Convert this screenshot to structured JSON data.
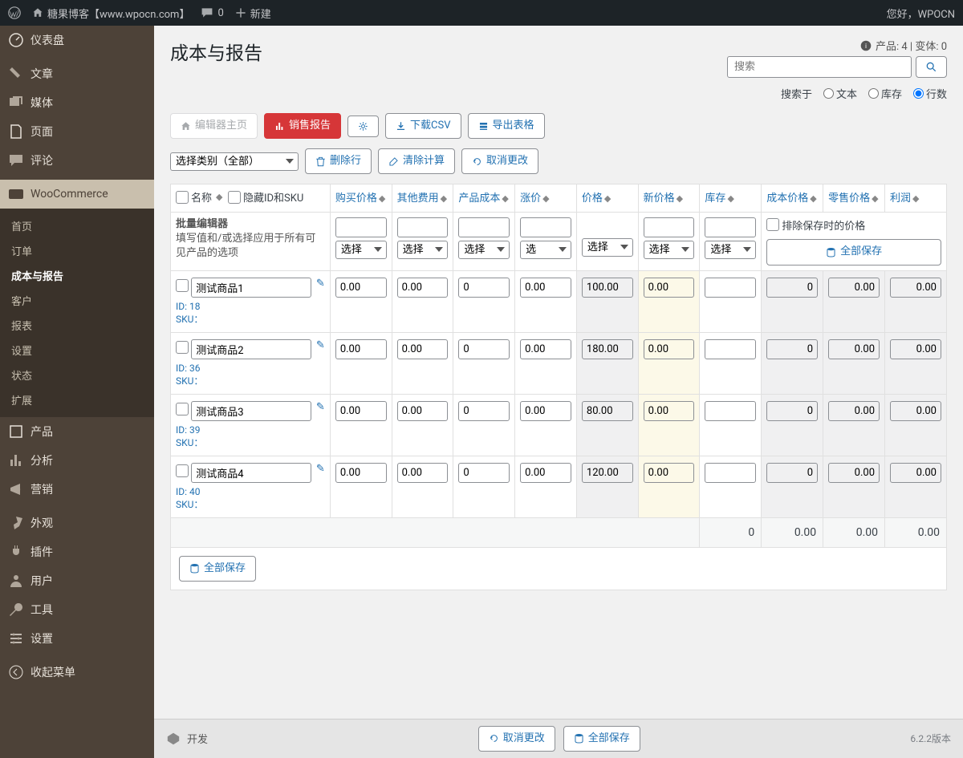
{
  "adminbar": {
    "site_title": "糖果博客【www.wpocn.com】",
    "comments": "0",
    "new": "新建",
    "greeting": "您好，WPOCN"
  },
  "sidebar": {
    "dashboard": "仪表盘",
    "posts": "文章",
    "media": "媒体",
    "pages": "页面",
    "comments": "评论",
    "woocommerce": "WooCommerce",
    "woosub": {
      "home": "首页",
      "orders": "订单",
      "cost_reports": "成本与报告",
      "customers": "客户",
      "reports": "报表",
      "settings": "设置",
      "status": "状态",
      "extensions": "扩展"
    },
    "products": "产品",
    "analytics": "分析",
    "marketing": "营销",
    "appearance": "外观",
    "plugins": "插件",
    "users": "用户",
    "tools": "工具",
    "settings": "设置",
    "collapse": "收起菜单"
  },
  "page": {
    "title": "成本与报告",
    "info_prefix": "产品: 4 | 变体: 0"
  },
  "toolbar": {
    "editor_home": "编辑器主页",
    "sales_report": "销售报告",
    "download_csv": "下载CSV",
    "export_table": "导出表格",
    "search_placeholder": "搜索",
    "search_by": "搜索于",
    "r_text": "文本",
    "r_stock": "库存",
    "r_rows": "行数",
    "select_category": "选择类别（全部）",
    "delete_rows": "删除行",
    "clear_calc": "清除计算",
    "undo_changes": "取消更改"
  },
  "table": {
    "headers": {
      "name": "名称",
      "hide_id_sku": "隐藏ID和SKU",
      "purchase_price": "购买价格",
      "other_cost": "其他费用",
      "product_cost": "产品成本",
      "markup": "涨价",
      "price": "价格",
      "new_price": "新价格",
      "stock": "库存",
      "cost_price": "成本价格",
      "retail_price": "零售价格",
      "profit": "利润"
    },
    "bulk": {
      "title": "批量编辑器",
      "desc": "填写值和/或选择应用于所有可见产品的选项",
      "select": "选择",
      "sel_short": "选",
      "exclude_saved_price": "排除保存时的价格",
      "save_all": "全部保存"
    },
    "rows": [
      {
        "name": "测试商品1",
        "id": "18",
        "sku": "",
        "purchase": "0.00",
        "other": "0.00",
        "cost": "0",
        "markup": "0.00",
        "price": "100.00",
        "new_price": "0.00",
        "stock": "",
        "cost_val": "0",
        "retail": "0.00",
        "profit": "0.00"
      },
      {
        "name": "测试商品2",
        "id": "36",
        "sku": "",
        "purchase": "0.00",
        "other": "0.00",
        "cost": "0",
        "markup": "0.00",
        "price": "180.00",
        "new_price": "0.00",
        "stock": "",
        "cost_val": "0",
        "retail": "0.00",
        "profit": "0.00"
      },
      {
        "name": "测试商品3",
        "id": "39",
        "sku": "",
        "purchase": "0.00",
        "other": "0.00",
        "cost": "0",
        "markup": "0.00",
        "price": "80.00",
        "new_price": "0.00",
        "stock": "",
        "cost_val": "0",
        "retail": "0.00",
        "profit": "0.00"
      },
      {
        "name": "测试商品4",
        "id": "40",
        "sku": "",
        "purchase": "0.00",
        "other": "0.00",
        "cost": "0",
        "markup": "0.00",
        "price": "120.00",
        "new_price": "0.00",
        "stock": "",
        "cost_val": "0",
        "retail": "0.00",
        "profit": "0.00"
      }
    ],
    "totals": {
      "stock": "0",
      "cost": "0.00",
      "retail": "0.00",
      "profit": "0.00"
    },
    "save_all_btn": "全部保存"
  },
  "bottombar": {
    "dev": "开发",
    "undo": "取消更改",
    "save_all": "全部保存",
    "version": "6.2.2版本"
  },
  "labels": {
    "id_prefix": "ID: ",
    "sku_prefix": "SKU："
  }
}
